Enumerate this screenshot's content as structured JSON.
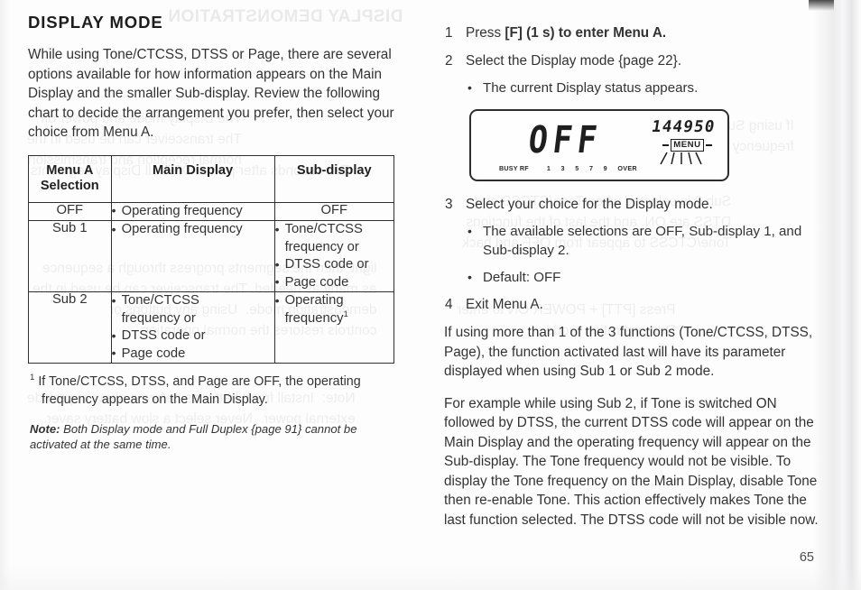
{
  "page": {
    "number": "65"
  },
  "left_column": {
    "section_title": "DISPLAY MODE",
    "intro_paragraph": "While using Tone/CTCSS, DTSS or Page, there are several options available for how information appears on the Main Display and the smaller Sub-display.  Review the following chart to decide the arrangement you prefer, then select your choice from Menu A.",
    "table": {
      "headers": {
        "menu_a_selection": "Menu A\nSelection",
        "menu_a_selection_line1": "Menu A",
        "menu_a_selection_line2": "Selection",
        "main_display": "Main Display",
        "sub_display": "Sub-display"
      },
      "rows": [
        {
          "selection": "OFF",
          "main_display": [
            "Operating frequency"
          ],
          "sub_display_plain": "OFF",
          "sub_display": []
        },
        {
          "selection": "Sub 1",
          "main_display": [
            "Operating frequency"
          ],
          "sub_display": [
            "Tone/CTCSS",
            "frequency or",
            "DTSS code or",
            "Page code"
          ]
        },
        {
          "selection": "Sub 2",
          "main_display": [
            "Tone/CTCSS",
            "frequency or",
            "DTSS code or",
            "Page code"
          ],
          "sub_display": [
            "Operating",
            "frequency"
          ]
        }
      ]
    },
    "footnote": {
      "marker": "1",
      "text": "If Tone/CTCSS, DTSS, and Page are OFF, the operating frequency appears on the Main Display."
    },
    "note": {
      "label": "Note:",
      "text": "Both Display mode and Full Duplex {page 91} cannot be activated at the same time."
    }
  },
  "right_column": {
    "steps": [
      {
        "number": "1",
        "text_before_key": "Press ",
        "key": "[F]",
        "text_after_key": " (1 s) to enter Menu A.",
        "full_text": "Press [F] (1 s) to enter Menu A."
      },
      {
        "number": "2",
        "full_text": "Select the Display mode {page 22}.",
        "sub_items": [
          "The current Display status appears."
        ]
      },
      {
        "number": "3",
        "full_text": "Select your choice for the Display mode.",
        "sub_items": [
          "The available selections are OFF, Sub-display 1, and Sub-display 2.",
          "Default: OFF"
        ]
      },
      {
        "number": "4",
        "full_text": "Exit Menu A."
      }
    ],
    "lcd_display": {
      "main_readout": "OFF",
      "frequency": "144950",
      "menu_indicator": "MENU",
      "scale": {
        "busy_label": "BUSY RF",
        "ticks": [
          "1",
          "3",
          "5",
          "7",
          "9"
        ],
        "over_label": "OVER"
      }
    },
    "paragraphs": [
      "If using more than 1 of the 3 functions (Tone/CTCSS, DTSS, Page), the function activated last will have its parameter displayed when using Sub 1 or Sub 2 mode.",
      "For example while using Sub 2, if Tone is switched ON followed by DTSS, the current DTSS code will appear on the Main Display and the operating frequency will appear on the Sub-display.  The Tone frequency would not be visible.  To display the Tone frequency on the Main Display, disable Tone then re-enable Tone.  This action effectively makes Tone the last function selected.  The DTSS code will not be visible now."
    ]
  },
  "scan_artifacts": {
    "bleed_heading": "DISPLAY DEMONSTRATION",
    "bleed_lines": [
      "The Display mode and power off\nThe transceiver can be used in the\nnormal reception and transmission",
      "Ten seconds after power OFF, all Display segments",
      "light, then the segments progress through a sequence\nas many as needed. The transceiver can be used in the\ndemonstration mode.  Using any buttons or\ncontrols restores the normal operation",
      "Note:  Install fresh batteries before a show or provide\nexternal power.  Never select a slow battery saver.",
      "note",
      "If using Sub 2 while Tone is ON, the Tone/CTCSS\nfrequency appears and DTSS code",
      "Sub 2 is selected when Tone/CTCSS and\nDTSS are ON, and the last of the functions\nTone/CTCSS to appear from OFF and back",
      "Press [PTT] + POWER ON to enter\nDemonstration mode."
    ]
  }
}
